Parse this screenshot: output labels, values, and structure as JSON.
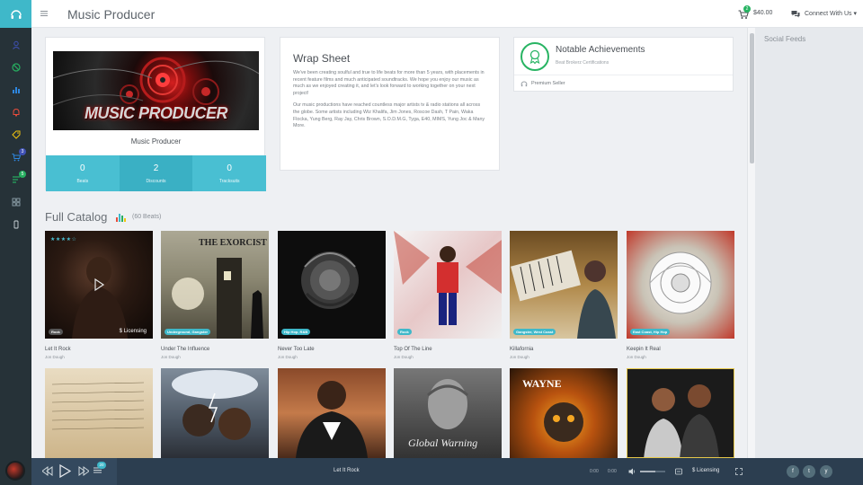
{
  "topbar": {
    "title": "Music Producer",
    "cart_count": "2",
    "cart_total": "$40.00",
    "connect_label": "Connect With Us ▾"
  },
  "rail": {
    "badges": [
      "3",
      "5"
    ]
  },
  "profile": {
    "banner_text": "MUSIC PRODUCER",
    "name": "Music Producer",
    "stats": [
      {
        "value": "0",
        "label": "Beats"
      },
      {
        "value": "2",
        "label": "Discounts"
      },
      {
        "value": "0",
        "label": "Tracksuits"
      }
    ]
  },
  "wrap_sheet": {
    "title": "Wrap Sheet",
    "p1": "We've been creating soulful and true to life beats for more than 5 years, with placements in recent feature films and much anticipated soundtracks. We hope you enjoy our music as much as we enjoyed creating it, and let's look forward to working together on your next project!",
    "p2": "Our music productions have reached countless major artists tv & radio stations all across the globe. Some artists including Wiz Khalifa, Jim Jones, Roscoe Dash, T Pain, Waka Flocka, Yung Berg, Ray Jay, Chris Brown, S.O.D.M.G, Tyga, E40, MIMS, Yung Joc & Many More."
  },
  "achievements": {
    "title": "Notable Achievements",
    "subtitle": "Beat Brokerz Certifications",
    "item": "Premium Seller"
  },
  "catalog": {
    "title": "Full Catalog",
    "count": "(60 Beats)",
    "row1": [
      {
        "title": "Let It Rock",
        "artist": "Jon Dough",
        "tag": "Rock",
        "stars": "★★★★☆",
        "licensing": "$ Licensing"
      },
      {
        "title": "Under The Influence",
        "artist": "Jon Dough",
        "tag": "Underground, Gangster",
        "overlay": "THE EXORCIST"
      },
      {
        "title": "Never Too Late",
        "artist": "Jon Dough",
        "tag": "Hip Hop, R&B"
      },
      {
        "title": "Top Of The Line",
        "artist": "Jon Dough",
        "tag": "Rock"
      },
      {
        "title": "Killafornia",
        "artist": "Jon Dough",
        "tag": "Gangster, West Coast"
      },
      {
        "title": "Keepin It Real",
        "artist": "Jon Dough",
        "tag": "East Coast, Hip Hop"
      }
    ],
    "row2": [
      {
        "overlay": ""
      },
      {
        "overlay": ""
      },
      {
        "overlay": ""
      },
      {
        "overlay": "Global Warning"
      },
      {
        "overlay": "WAYNE"
      },
      {
        "overlay": ""
      }
    ]
  },
  "right_panel": {
    "title": "Social Feeds"
  },
  "player": {
    "playlist_count": "20",
    "now_playing": "Let It Rock",
    "time_current": "0:00",
    "time_total": "0:00",
    "licensing": "$ Licensing"
  },
  "social": [
    "f",
    "t",
    "y"
  ]
}
